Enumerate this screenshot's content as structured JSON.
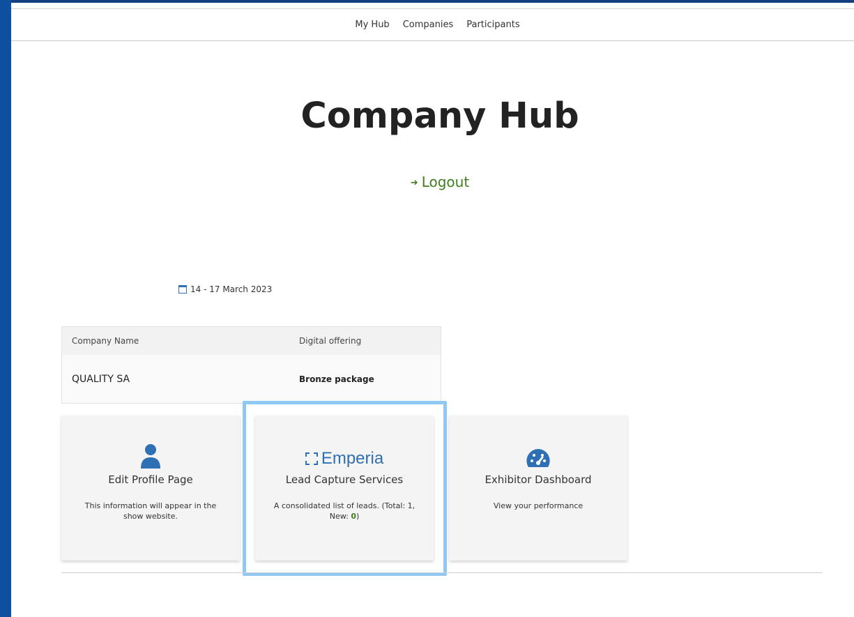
{
  "nav": {
    "items": [
      "My Hub",
      "Companies",
      "Participants"
    ]
  },
  "hub": {
    "title": "Company Hub",
    "logout_label": "Logout",
    "date_range": "14 - 17 March 2023"
  },
  "company_table": {
    "headers": [
      "Company Name",
      "Digital offering"
    ],
    "row": {
      "company_name": "QUALITY SA",
      "digital_offering": "Bronze package"
    }
  },
  "cards": [
    {
      "icon": "person-icon",
      "title": "Edit Profile Page",
      "description": "This information will appear in the show website."
    },
    {
      "icon": "emperia-logo",
      "logo_text": "Emperia",
      "title": "Lead Capture Services",
      "description_prefix": "A consolidated list of leads. (Total: 1, New: ",
      "new_count": "0",
      "description_suffix": ")"
    },
    {
      "icon": "dashboard-gauge-icon",
      "title": "Exhibitor Dashboard",
      "description": "View your performance"
    }
  ],
  "colors": {
    "accent_green": "#3f7f1e",
    "brand_blue": "#2f6fb3",
    "highlight": "#8fc8f2"
  }
}
